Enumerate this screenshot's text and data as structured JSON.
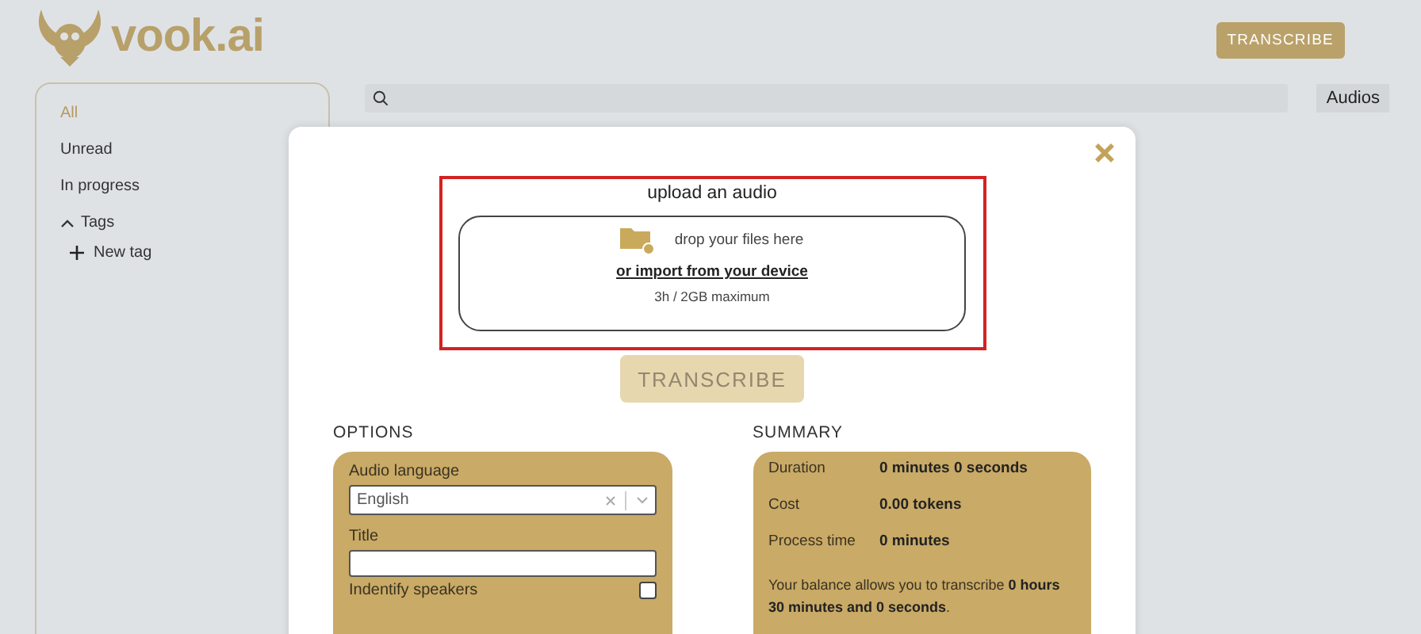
{
  "header": {
    "logo": "vook.ai",
    "transcribe_button": "TRANSCRIBE"
  },
  "sidebar": {
    "items": [
      {
        "label": "All",
        "selected": true
      },
      {
        "label": "Unread",
        "selected": false
      },
      {
        "label": "In progress",
        "selected": false
      }
    ],
    "tags": {
      "label": "Tags",
      "expanded": true,
      "new_tag": "New tag"
    }
  },
  "audios_button": "Audios",
  "modal": {
    "upload": {
      "title": "upload an audio",
      "drop_text": "drop your files here",
      "import_link": "or import from your device",
      "limit": "3h / 2GB maximum"
    },
    "transcribe_button": {
      "label": "TRANSCRIBE",
      "disabled": true
    },
    "options": {
      "heading": "OPTIONS",
      "language_label": "Audio language",
      "language_value": "English",
      "title_label": "Title",
      "speakers_label": "Indentify speakers",
      "speakers_checked": false
    },
    "summary": {
      "heading": "SUMMARY",
      "rows": [
        {
          "label": "Duration",
          "value": "0 minutes 0 seconds"
        },
        {
          "label": "Cost",
          "value": "0.00 tokens"
        },
        {
          "label": "Process time",
          "value": "0 minutes"
        }
      ],
      "balance": "Your balance allows you to transcribe **0 hours 30 minutes and 0 seconds**."
    }
  }
}
